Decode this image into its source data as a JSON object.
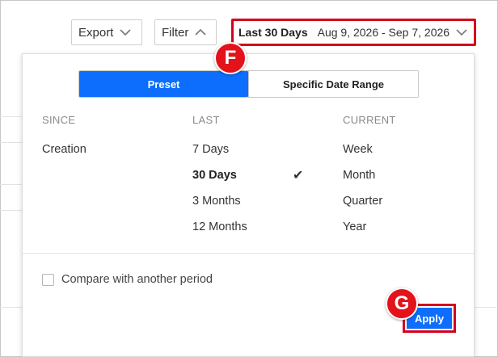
{
  "toolbar": {
    "export_label": "Export",
    "filter_label": "Filter",
    "date_preset_label": "Last 30 Days",
    "date_range_label": "Aug 9, 2026 - Sep 7, 2026"
  },
  "date_panel": {
    "tabs": [
      {
        "label": "Preset",
        "active": true
      },
      {
        "label": "Specific Date Range",
        "active": false
      }
    ],
    "columns": {
      "since": {
        "header": "SINCE",
        "items": [
          "Creation"
        ]
      },
      "last": {
        "header": "LAST",
        "items": [
          "7 Days",
          "30 Days",
          "3 Months",
          "12 Months"
        ],
        "selected": "30 Days"
      },
      "current": {
        "header": "CURRENT",
        "items": [
          "Week",
          "Month",
          "Quarter",
          "Year"
        ]
      }
    },
    "compare_label": "Compare with another period",
    "compare_checked": false,
    "apply_label": "Apply"
  },
  "annotations": {
    "badge_f": "F",
    "badge_g": "G"
  },
  "colors": {
    "accent": "#0d6efd",
    "highlight": "#d5001c",
    "badge": "#e3121b"
  }
}
